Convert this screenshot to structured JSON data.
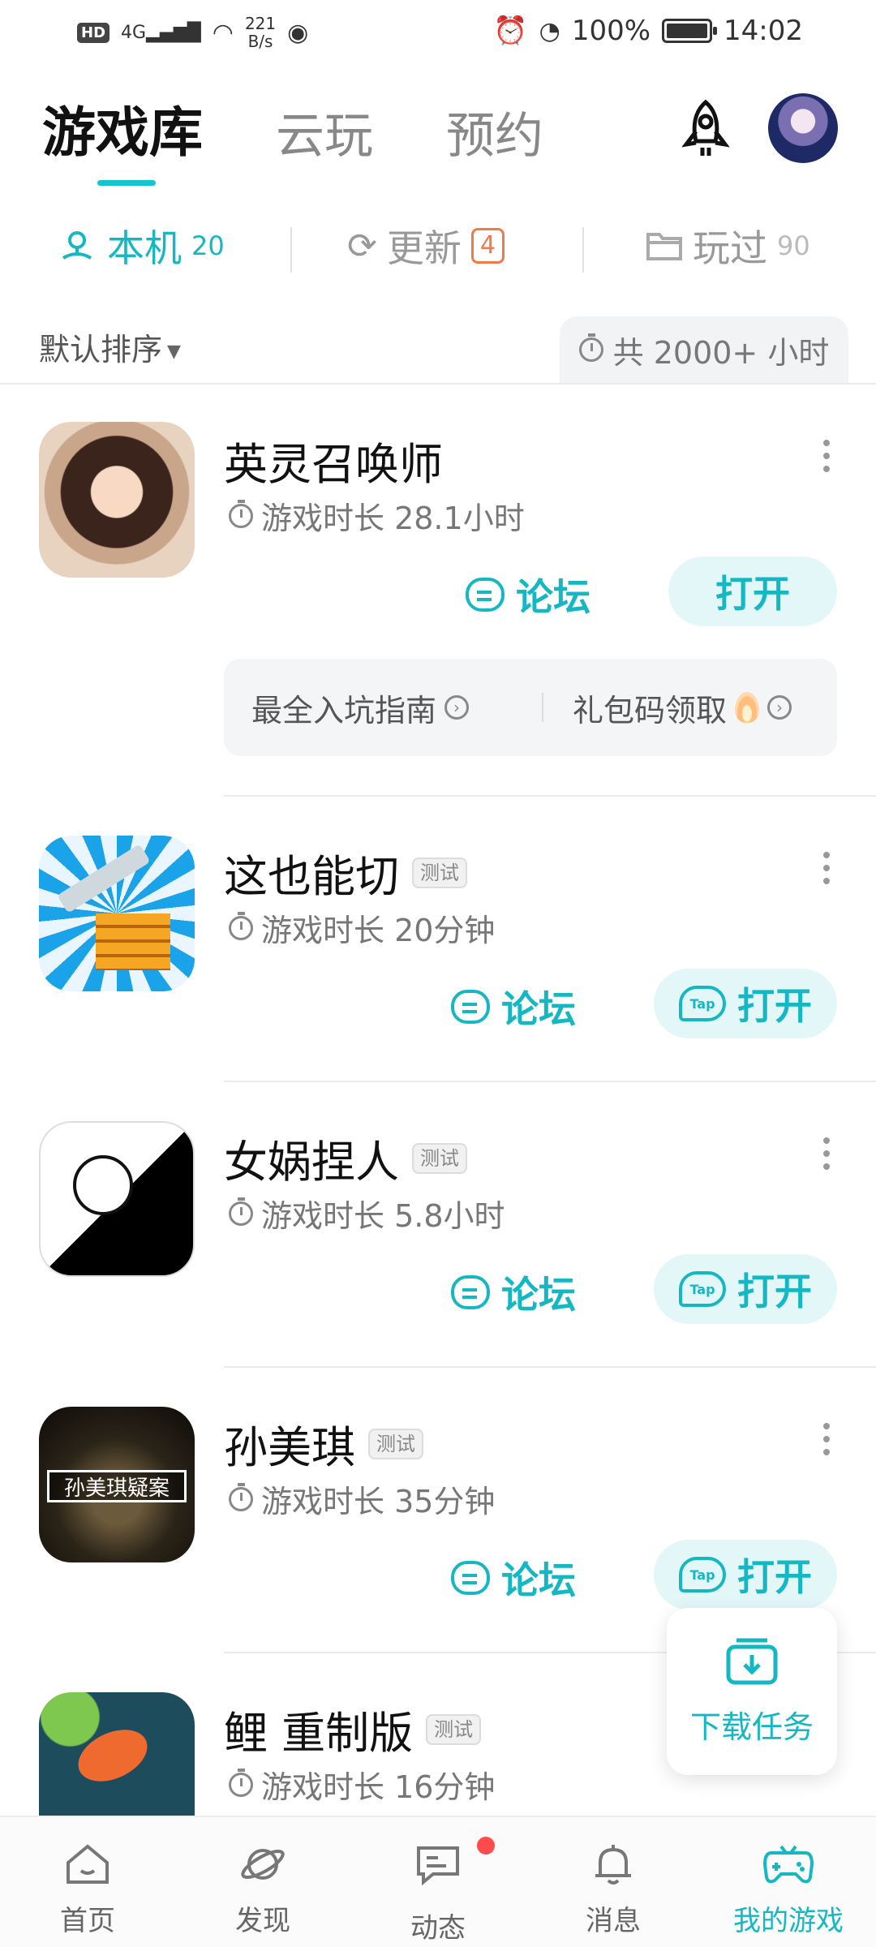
{
  "status_bar": {
    "hd": "HD",
    "net_type": "4G",
    "speed_value": "221",
    "speed_unit": "B/s",
    "battery": "100%",
    "battery_level": 1.0,
    "time": "14:02"
  },
  "top_tabs": [
    "游戏库",
    "云玩",
    "预约"
  ],
  "sub_tabs": {
    "local": {
      "label": "本机",
      "count": "20"
    },
    "update": {
      "label": "更新",
      "count": "4"
    },
    "played": {
      "label": "玩过",
      "count": "90"
    }
  },
  "sort_label": "默认排序",
  "total_time": "共 2000+ 小时",
  "games": [
    {
      "title": "英灵召唤师",
      "tag": "",
      "time": "游戏时长 28.1小时",
      "forum": "论坛",
      "open": "打开"
    },
    {
      "title": "这也能切",
      "tag": "测试",
      "time": "游戏时长 20分钟",
      "forum": "论坛",
      "open": "打开"
    },
    {
      "title": "女娲捏人",
      "tag": "测试",
      "time": "游戏时长 5.8小时",
      "forum": "论坛",
      "open": "打开"
    },
    {
      "title": "孙美琪",
      "tag": "测试",
      "time": "游戏时长 35分钟",
      "forum": "论坛",
      "open": "打开",
      "icon_text": "孙美琪疑案"
    },
    {
      "title": "鲤 重制版",
      "tag": "测试",
      "time": "游戏时长 16分钟"
    }
  ],
  "guide_links": {
    "first": "最全入坑指南",
    "second": "礼包码领取"
  },
  "download_task": "下载任务",
  "bottom_nav": [
    "首页",
    "发现",
    "动态",
    "消息",
    "我的游戏"
  ],
  "colors": {
    "accent": "#15b8c2",
    "badge": "#f07a4a",
    "notify": "#ff4b4b"
  }
}
